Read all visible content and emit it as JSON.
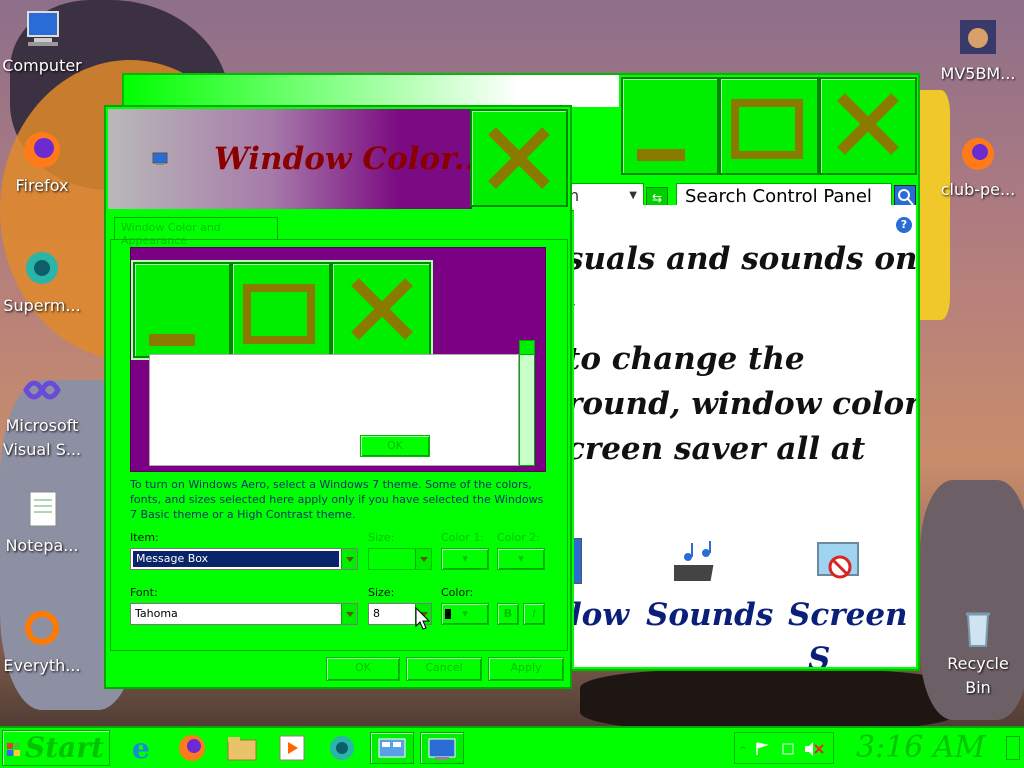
{
  "desktop": {
    "icons": [
      {
        "label": "Computer"
      },
      {
        "label": "Firefox"
      },
      {
        "label": "Superm..."
      },
      {
        "label": "Microsoft\nVisual S..."
      },
      {
        "label": "Notepa..."
      },
      {
        "label": "Everyth..."
      },
      {
        "label": "MV5BM..."
      },
      {
        "label": "club-pe..."
      },
      {
        "label": "Recycle\nBin"
      }
    ]
  },
  "control_panel": {
    "search_placeholder": "Search Control Panel",
    "address_partial": "n",
    "text_lines": [
      "suals and sounds on",
      ",",
      " to change the",
      "round, window color,",
      "creen saver all at"
    ],
    "links": [
      "dow",
      "Sounds",
      "Screen"
    ],
    "link_bottom": "S"
  },
  "dialog": {
    "title": "Window Color...",
    "tab": "Window Color and Appearance",
    "preview_ok": "OK",
    "info_text": "To turn on Windows Aero, select a Windows 7 theme.  Some of the colors, fonts, and sizes selected here apply only if you have selected the Windows 7 Basic theme or a High Contrast theme.",
    "item_label": "Item:",
    "item_value": "Message Box",
    "size_label_top": "Size:",
    "color1_label": "Color 1:",
    "color2_label": "Color 2:",
    "font_label": "Font:",
    "font_value": "Tahoma",
    "size_label": "Size:",
    "size_value": "8",
    "color_label": "Color:",
    "bold_label": "B",
    "italic_label": "I",
    "ok_label": "OK",
    "cancel_label": "Cancel",
    "apply_label": "Apply"
  },
  "taskbar": {
    "start_label": "Start",
    "clock": "3:16 AM"
  },
  "colors": {
    "chrome_green": "#00ff00",
    "title_red": "#8a0000",
    "selection_blue": "#0a246a",
    "link_blue": "#0a1f7a"
  }
}
